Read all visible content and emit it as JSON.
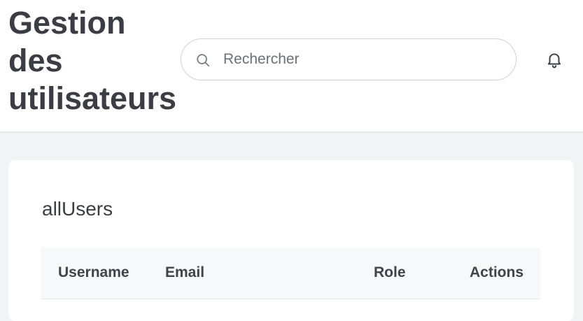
{
  "header": {
    "title": "Gestion des utilisateurs",
    "search": {
      "placeholder": "Rechercher",
      "value": ""
    },
    "icons": {
      "search": "search-icon",
      "notifications": "bell-icon"
    }
  },
  "card": {
    "title": "allUsers",
    "table": {
      "columns": [
        "Username",
        "Email",
        "Role",
        "Actions"
      ]
    }
  },
  "colors": {
    "background": "#f2f3f5",
    "surface": "#ffffff",
    "text": "#3a3d44",
    "table_header_bg": "#f7f8fa"
  }
}
